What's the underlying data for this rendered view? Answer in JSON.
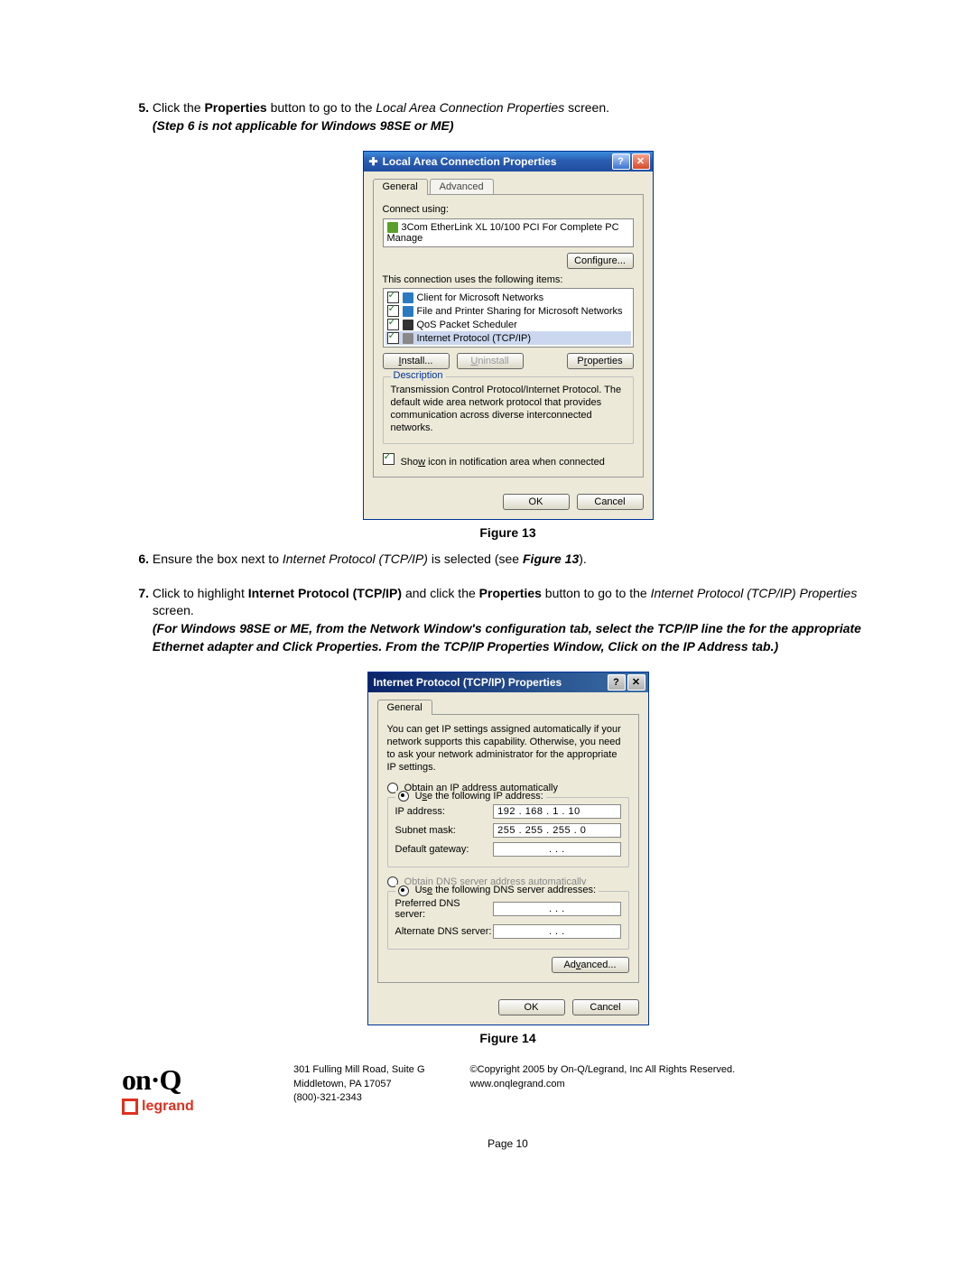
{
  "step5": {
    "num": "5.",
    "pre": "Click the ",
    "b1": "Properties",
    "mid": " button to go to the ",
    "i1": "Local Area Connection Properties",
    "post": " screen.",
    "note": "(Step 6 is not applicable for Windows 98SE or ME)"
  },
  "dialog1": {
    "title": "Local Area Connection Properties",
    "tabs": {
      "general": "General",
      "advanced": "Advanced"
    },
    "connect_using": "Connect using:",
    "adapter": "3Com EtherLink XL 10/100 PCI For Complete PC Manage",
    "configure": "Configure...",
    "items_label": "This connection uses the following items:",
    "items": [
      "Client for Microsoft Networks",
      "File and Printer Sharing for Microsoft Networks",
      "QoS Packet Scheduler",
      "Internet Protocol (TCP/IP)"
    ],
    "install": "Install...",
    "uninstall": "Uninstall",
    "properties": "Properties",
    "desc_legend": "Description",
    "desc": "Transmission Control Protocol/Internet Protocol. The default wide area network protocol that provides communication across diverse interconnected networks.",
    "show_icon": "Show icon in notification area when connected",
    "ok": "OK",
    "cancel": "Cancel"
  },
  "fig1_caption": "Figure 13",
  "step6": {
    "num": "6.",
    "pre": "Ensure the box next to ",
    "i1": "Internet Protocol (TCP/IP)",
    "mid": " is selected (see ",
    "b1": "Figure 13",
    "post": ")."
  },
  "step7": {
    "num": "7.",
    "pre": "Click to highlight ",
    "b1": "Internet Protocol (TCP/IP)",
    "mid1": " and click the ",
    "b2": "Properties",
    "mid2": " button to go to the ",
    "i1": "Internet Protocol (TCP/IP) Properties",
    "post": " screen.",
    "note": "(For Windows 98SE or ME, from the Network Window's configuration tab, select the TCP/IP line the for the appropriate Ethernet adapter and Click Properties. From the TCP/IP Properties Window, Click on the IP Address tab.)"
  },
  "dialog2": {
    "title": "Internet Protocol (TCP/IP) Properties",
    "tab_general": "General",
    "info": "You can get IP settings assigned automatically if your network supports this capability. Otherwise, you need to ask your network administrator for the appropriate IP settings.",
    "opt_auto": "Obtain an IP address automatically",
    "opt_manual": "Use the following IP address:",
    "ip_label": "IP address:",
    "ip_value": "192 . 168 .  1  .  10",
    "subnet_label": "Subnet mask:",
    "subnet_value": "255 . 255 . 255 .  0",
    "gw_label": "Default gateway:",
    "gw_value": ".       .       .",
    "dns_auto": "Obtain DNS server address automatically",
    "dns_manual": "Use the following DNS server addresses:",
    "pref_dns_label": "Preferred DNS server:",
    "pref_dns_value": ".       .       .",
    "alt_dns_label": "Alternate DNS server:",
    "alt_dns_value": ".       .       .",
    "advanced": "Advanced...",
    "ok": "OK",
    "cancel": "Cancel"
  },
  "fig2_caption": "Figure 14",
  "footer": {
    "logo1": "on·Q",
    "logo2": "legrand",
    "addr1": "301 Fulling Mill Road, Suite G",
    "addr2": "Middletown, PA   17057",
    "addr3": "(800)-321-2343",
    "copy": "©Copyright 2005 by On-Q/Legrand, Inc All Rights Reserved.",
    "web": "www.onqlegrand.com",
    "pagenum": "Page 10"
  }
}
